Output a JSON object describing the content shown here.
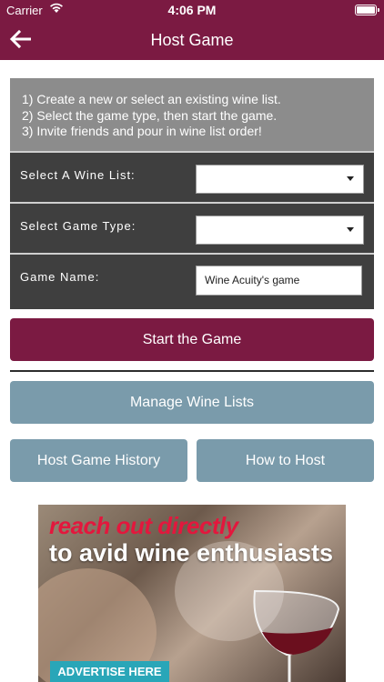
{
  "status_bar": {
    "carrier": "Carrier",
    "time": "4:06 PM"
  },
  "nav": {
    "title": "Host Game",
    "back_icon": "arrow-left-icon"
  },
  "instructions": [
    "1) Create a new or select an existing wine list.",
    "2) Select the game type, then start the game.",
    "3) Invite friends and pour in wine list order!"
  ],
  "form": {
    "wine_list_label": "Select A Wine List:",
    "wine_list_value": "",
    "game_type_label": "Select Game Type:",
    "game_type_value": "",
    "game_name_label": "Game Name:",
    "game_name_value": "Wine Acuity's game"
  },
  "buttons": {
    "start": "Start the Game",
    "manage": "Manage Wine Lists",
    "history": "Host Game History",
    "howto": "How to Host"
  },
  "ad": {
    "headline_1": "reach out directly",
    "headline_2": "to avid wine enthusiasts",
    "cta": "ADVERTISE HERE"
  },
  "colors": {
    "primary": "#7b1a42",
    "secondary_button": "#7a9bab",
    "panel_gray": "#8c8c8c",
    "row_dark": "#3f3f3f",
    "ad_cta": "#29a6b8"
  }
}
